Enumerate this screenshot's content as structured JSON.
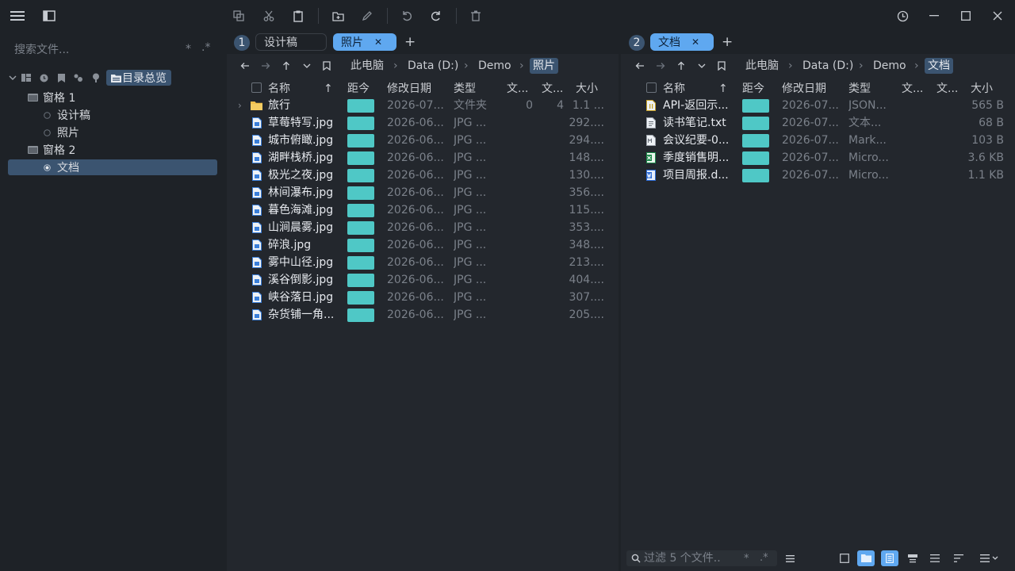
{
  "toolbar": {
    "history_icon": "history-icon",
    "undo_icon": "undo-icon",
    "redo_icon": "redo-icon"
  },
  "sidebar": {
    "search_placeholder": "搜索文件...",
    "search_star": "*",
    "search_regex": ".*",
    "overview_label": "目录总览",
    "panes": [
      {
        "label": "窗格 1",
        "tabs": [
          "设计稿",
          "照片"
        ]
      },
      {
        "label": "窗格 2",
        "tabs": [
          "文档"
        ]
      }
    ]
  },
  "left_pane": {
    "number": "1",
    "tabs": [
      {
        "label": "设计稿"
      },
      {
        "label": "照片",
        "close": "✕"
      }
    ],
    "add_tab": "+",
    "breadcrumb": [
      "此电脑",
      "Data (D:)",
      "Demo",
      "照片"
    ],
    "columns": [
      "名称",
      "距今",
      "修改日期",
      "类型",
      "文...",
      "文...",
      "大小"
    ],
    "sort_arrow": "↑",
    "rows": [
      {
        "name": "旅行",
        "date": "2026-07...",
        "type": "文件夹",
        "files": "0",
        "folders": "4",
        "size": "1.1 ...",
        "kind": "folder"
      },
      {
        "name": "草莓特写.jpg",
        "date": "2026-06...",
        "type": "JPG ...",
        "size": "292....",
        "kind": "image"
      },
      {
        "name": "城市俯瞰.jpg",
        "date": "2026-06...",
        "type": "JPG ...",
        "size": "294....",
        "kind": "image"
      },
      {
        "name": "湖畔栈桥.jpg",
        "date": "2026-06...",
        "type": "JPG ...",
        "size": "148....",
        "kind": "image"
      },
      {
        "name": "极光之夜.jpg",
        "date": "2026-06...",
        "type": "JPG ...",
        "size": "130....",
        "kind": "image"
      },
      {
        "name": "林间瀑布.jpg",
        "date": "2026-06...",
        "type": "JPG ...",
        "size": "356....",
        "kind": "image"
      },
      {
        "name": "暮色海滩.jpg",
        "date": "2026-06...",
        "type": "JPG ...",
        "size": "115....",
        "kind": "image"
      },
      {
        "name": "山涧晨雾.jpg",
        "date": "2026-06...",
        "type": "JPG ...",
        "size": "353....",
        "kind": "image"
      },
      {
        "name": "碎浪.jpg",
        "date": "2026-06...",
        "type": "JPG ...",
        "size": "348....",
        "kind": "image"
      },
      {
        "name": "雾中山径.jpg",
        "date": "2026-06...",
        "type": "JPG ...",
        "size": "213....",
        "kind": "image"
      },
      {
        "name": "溪谷倒影.jpg",
        "date": "2026-06...",
        "type": "JPG ...",
        "size": "404....",
        "kind": "image"
      },
      {
        "name": "峡谷落日.jpg",
        "date": "2026-06...",
        "type": "JPG ...",
        "size": "307....",
        "kind": "image"
      },
      {
        "name": "杂货铺一角...",
        "date": "2026-06...",
        "type": "JPG ...",
        "size": "205....",
        "kind": "image"
      }
    ]
  },
  "right_pane": {
    "number": "2",
    "tabs": [
      {
        "label": "文档",
        "close": "✕"
      }
    ],
    "add_tab": "+",
    "breadcrumb": [
      "此电脑",
      "Data (D:)",
      "Demo",
      "文档"
    ],
    "columns": [
      "名称",
      "距今",
      "修改日期",
      "类型",
      "文...",
      "文...",
      "大小"
    ],
    "sort_arrow": "↑",
    "rows": [
      {
        "name": "API-返回示...",
        "date": "2026-07...",
        "type": "JSON...",
        "size": "565 B",
        "kind": "json"
      },
      {
        "name": "读书笔记.txt",
        "date": "2026-07...",
        "type": "文本...",
        "size": "68 B",
        "kind": "text"
      },
      {
        "name": "会议纪要-0...",
        "date": "2026-07...",
        "type": "Mark...",
        "size": "103 B",
        "kind": "markdown"
      },
      {
        "name": "季度销售明...",
        "date": "2026-07...",
        "type": "Micro...",
        "size": "3.6 KB",
        "kind": "excel"
      },
      {
        "name": "项目周报.d...",
        "date": "2026-07...",
        "type": "Micro...",
        "size": "1.1 KB",
        "kind": "word"
      }
    ],
    "filter_placeholder": "过滤 5 个文件..",
    "filter_star": "*",
    "filter_regex": ".*"
  },
  "colors": {
    "accent": "#5fa8f0",
    "age_bar": "#4fc8c6",
    "selection": "#3b5470"
  }
}
